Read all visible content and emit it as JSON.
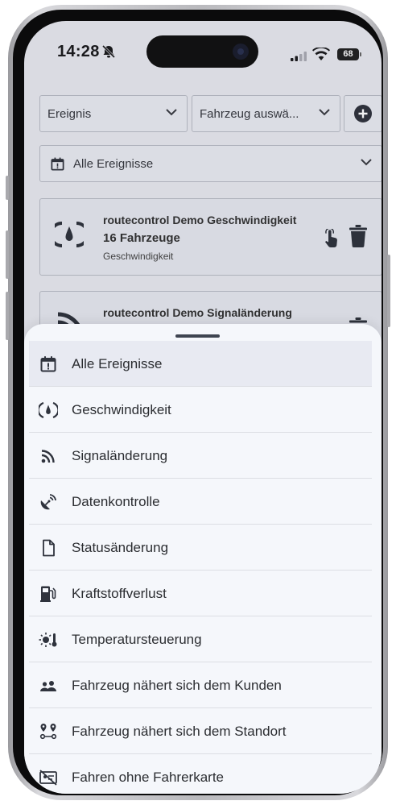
{
  "status_bar": {
    "time": "14:28",
    "battery": "68"
  },
  "filters": {
    "event_select": "Ereignis",
    "vehicle_select": "Fahrzeug auswä...",
    "date_filter": "Alle Ereignisse"
  },
  "cards": [
    {
      "title": "routecontrol Demo Geschwindigkeit",
      "count": "16 Fahrzeuge",
      "type": "Geschwindigkeit"
    },
    {
      "title": "routecontrol Demo Signaländerung"
    }
  ],
  "sheet": {
    "items": [
      {
        "label": "Alle Ereignisse",
        "icon": "calendar-alert-icon",
        "selected": true
      },
      {
        "label": "Geschwindigkeit",
        "icon": "speedometer-icon"
      },
      {
        "label": "Signaländerung",
        "icon": "signal-rss-icon"
      },
      {
        "label": "Datenkontrolle",
        "icon": "satellite-dish-icon"
      },
      {
        "label": "Statusänderung",
        "icon": "document-icon"
      },
      {
        "label": "Kraftstoffverlust",
        "icon": "fuel-pump-icon"
      },
      {
        "label": "Temperatursteuerung",
        "icon": "temperature-sun-icon"
      },
      {
        "label": "Fahrzeug nähert sich dem Kunden",
        "icon": "people-icon"
      },
      {
        "label": "Fahrzeug nähert sich dem Standort",
        "icon": "location-route-icon"
      },
      {
        "label": "Fahren ohne Fahrerkarte",
        "icon": "driver-card-icon"
      }
    ]
  },
  "colors": {
    "icon": "#2f333d",
    "sheet_bg": "#f5f7fb",
    "screen_bg": "#e7e8ee"
  }
}
